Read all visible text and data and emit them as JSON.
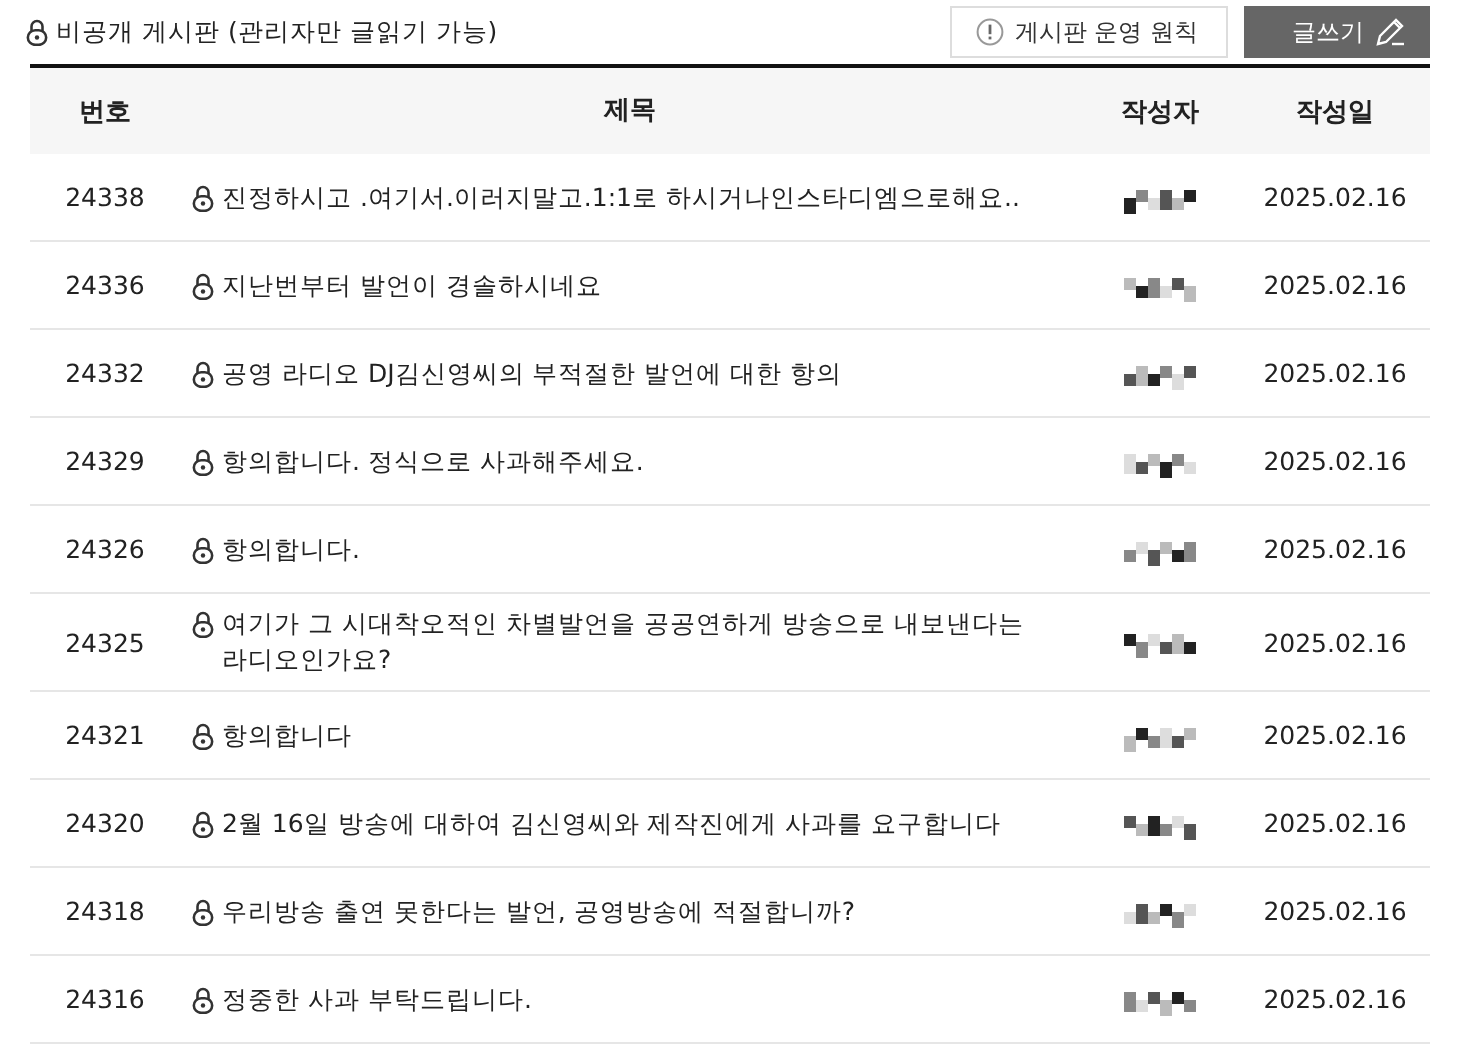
{
  "board": {
    "title": "비공개 게시판 (관리자만 글읽기 가능)",
    "locked": true
  },
  "buttons": {
    "rules": "게시판 운영 원칙",
    "write": "글쓰기"
  },
  "table": {
    "columns": [
      "번호",
      "제목",
      "작성자",
      "작성일"
    ],
    "rows": [
      {
        "number": "24338",
        "title": "진정하시고 .여기서.이러지말고.1:1로 하시거나인스타디엠으로해요..",
        "locked": true,
        "date": "2025.02.16"
      },
      {
        "number": "24336",
        "title": "지난번부터 발언이 경솔하시네요",
        "locked": true,
        "date": "2025.02.16"
      },
      {
        "number": "24332",
        "title": "공영 라디오 DJ김신영씨의 부적절한 발언에 대한 항의",
        "locked": true,
        "date": "2025.02.16"
      },
      {
        "number": "24329",
        "title": "항의합니다. 정식으로 사과해주세요.",
        "locked": true,
        "date": "2025.02.16"
      },
      {
        "number": "24326",
        "title": "항의합니다.",
        "locked": true,
        "date": "2025.02.16"
      },
      {
        "number": "24325",
        "title": "여기가 그 시대착오적인 차별발언을 공공연하게 방송으로 내보낸다는 라디오인가요?",
        "locked": true,
        "date": "2025.02.16"
      },
      {
        "number": "24321",
        "title": "항의합니다",
        "locked": true,
        "date": "2025.02.16"
      },
      {
        "number": "24320",
        "title": "2월 16일 방송에 대하여 김신영씨와 제작진에게 사과를 요구합니다",
        "locked": true,
        "date": "2025.02.16"
      },
      {
        "number": "24318",
        "title": "우리방송 출연 못한다는 발언, 공영방송에 적절합니까?",
        "locked": true,
        "date": "2025.02.16"
      },
      {
        "number": "24316",
        "title": "정중한 사과 부탁드립니다.",
        "locked": true,
        "date": "2025.02.16"
      }
    ]
  }
}
